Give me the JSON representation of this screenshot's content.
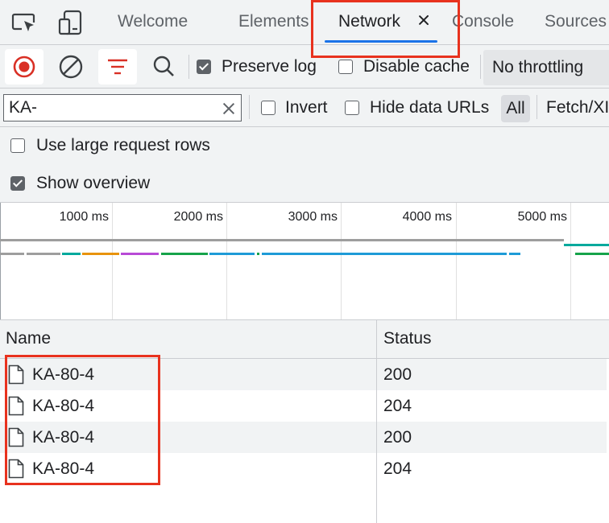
{
  "tabs": [
    {
      "name": "tab-welcome",
      "label": "Welcome",
      "active": false
    },
    {
      "name": "tab-elements",
      "label": "Elements",
      "active": false
    },
    {
      "name": "tab-network",
      "label": "Network",
      "active": true
    },
    {
      "name": "tab-console",
      "label": "Console",
      "active": false
    },
    {
      "name": "tab-sources",
      "label": "Sources",
      "active": false
    }
  ],
  "toolbar": {
    "icons": [
      "record-icon",
      "clear-icon",
      "filter-icon",
      "search-icon"
    ],
    "preserve_log": {
      "label": "Preserve log",
      "checked": true
    },
    "disable_cache": {
      "label": "Disable cache",
      "checked": false
    },
    "throttling": "No throttling"
  },
  "filter": {
    "value": "KA-",
    "invert": {
      "label": "Invert",
      "checked": false
    },
    "hide_data_urls": {
      "label": "Hide data URLs",
      "checked": false
    },
    "type_all": "All",
    "type_next": "Fetch/XI"
  },
  "options": {
    "large_rows": {
      "label": "Use large request rows",
      "checked": false
    },
    "show_overview": {
      "label": "Show overview",
      "checked": true
    }
  },
  "overview": {
    "ticks": [
      "1000 ms",
      "2000 ms",
      "3000 ms",
      "4000 ms",
      "5000 ms"
    ]
  },
  "table": {
    "headers": {
      "name": "Name",
      "status": "Status"
    },
    "rows": [
      {
        "name": "KA-80-4",
        "status": "200"
      },
      {
        "name": "KA-80-4",
        "status": "204"
      },
      {
        "name": "KA-80-4",
        "status": "200"
      },
      {
        "name": "KA-80-4",
        "status": "204"
      }
    ]
  },
  "colors": {
    "accent": "#1a73e8",
    "record": "#d93025",
    "highlight": "#e8321e"
  }
}
